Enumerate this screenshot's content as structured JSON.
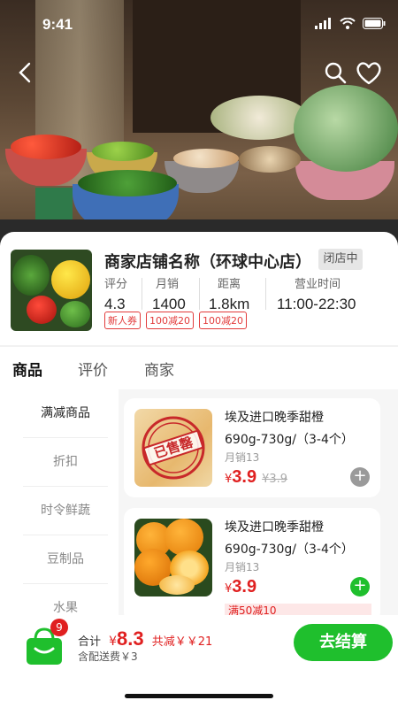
{
  "status_bar": {
    "time": "9:41"
  },
  "shop": {
    "name": "商家店铺名称（环球中心店）",
    "status_badge": "闭店中",
    "stats": [
      {
        "label": "评分",
        "value": "4.3"
      },
      {
        "label": "月销",
        "value": "1400"
      },
      {
        "label": "距离",
        "value": "1.8km"
      },
      {
        "label": "营业时间",
        "value": "11:00-22:30"
      }
    ],
    "tags": [
      "新人券",
      "100减20",
      "100减20"
    ]
  },
  "tabs": [
    {
      "label": "商品",
      "active": true
    },
    {
      "label": "评价",
      "active": false
    },
    {
      "label": "商家",
      "active": false
    }
  ],
  "categories": [
    {
      "label": "满减商品",
      "active": true
    },
    {
      "label": "折扣",
      "active": false
    },
    {
      "label": "时令鲜蔬",
      "active": false
    },
    {
      "label": "豆制品",
      "active": false
    },
    {
      "label": "水果",
      "active": false
    }
  ],
  "products": [
    {
      "title": "埃及进口晚季甜橙",
      "spec": "690g-730g/（3-4个）",
      "sales": "月销13",
      "currency": "¥",
      "price": "3.9",
      "old_price": "¥3.9",
      "sold_out_stamp": "已售罄",
      "add_icon": "plus-icon",
      "add_color": "#9a9a9a"
    },
    {
      "title": "埃及进口晚季甜橙",
      "spec": "690g-730g/（3-4个）",
      "sales": "月销13",
      "currency": "¥",
      "price": "3.9",
      "promo": "满50减10",
      "add_icon": "plus-icon",
      "add_color": "#1fbf2d"
    }
  ],
  "cart": {
    "badge_count": "9",
    "total_label": "合计",
    "currency": "¥",
    "total_value": "8.3",
    "discount": "共减￥￥21",
    "delivery": "含配送费￥3",
    "checkout_label": "去结算"
  },
  "colors": {
    "accent_green": "#1fbf2d",
    "price_red": "#e02020"
  }
}
